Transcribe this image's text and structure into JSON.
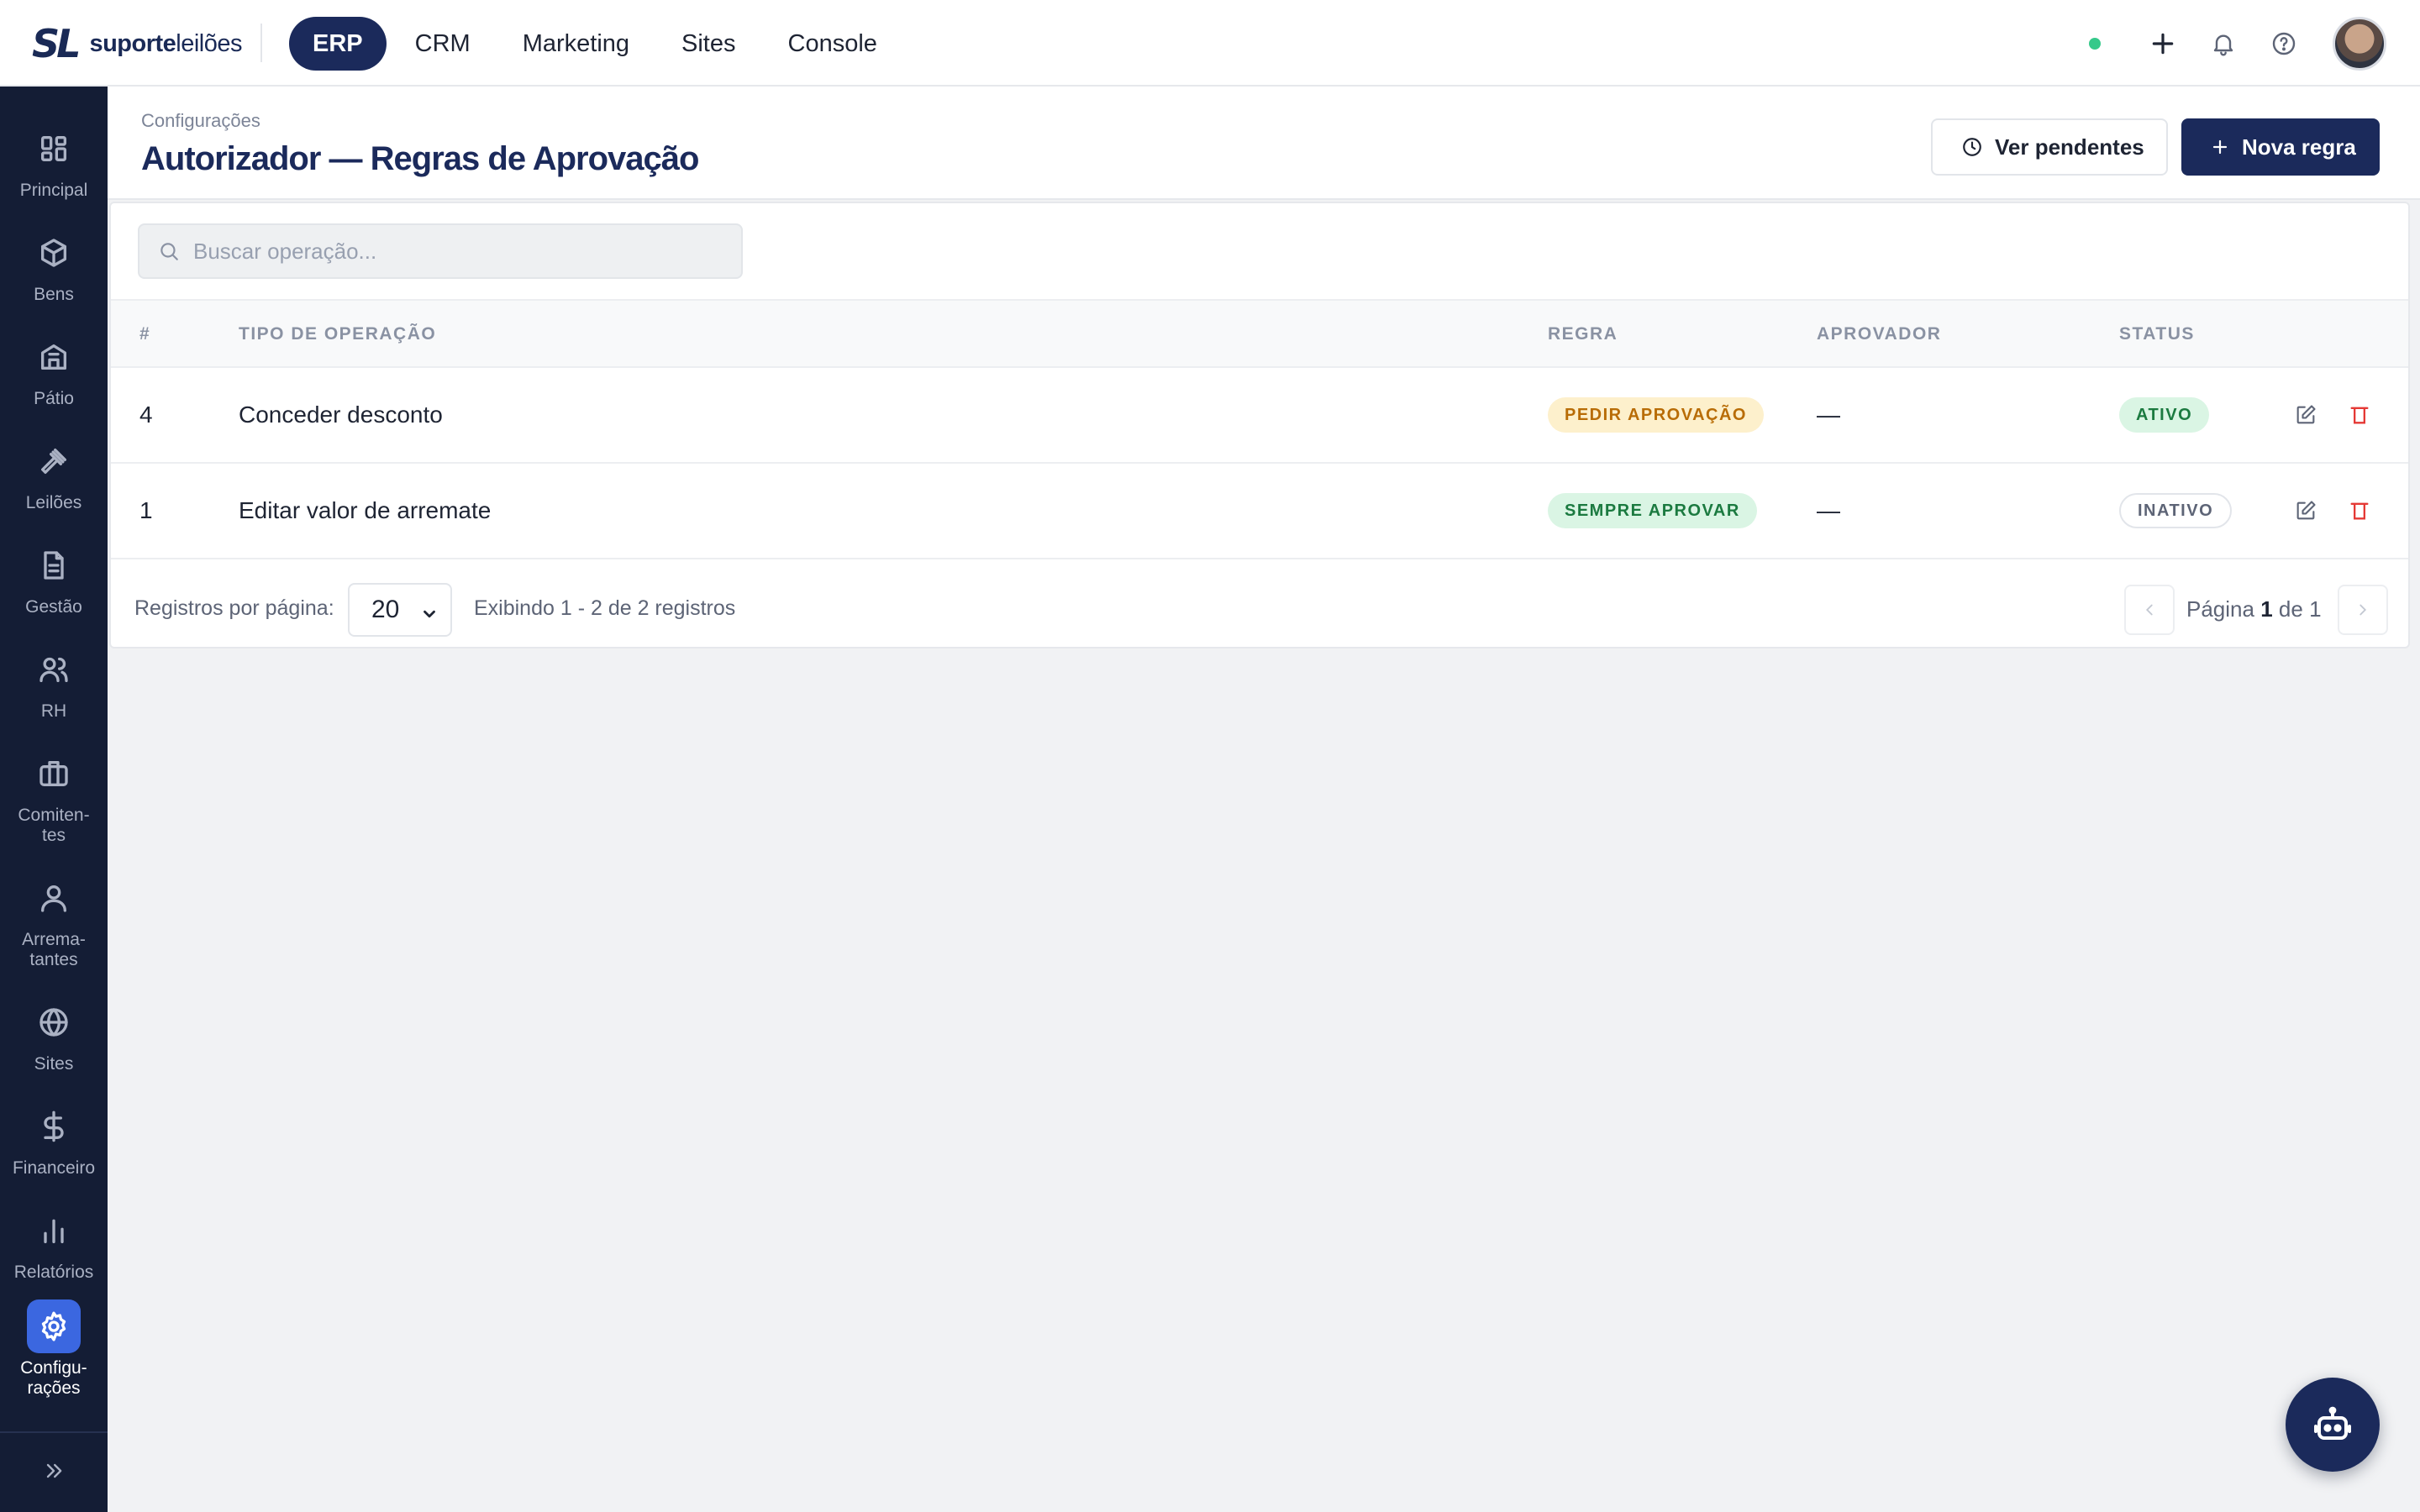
{
  "brand": {
    "mark": "SL",
    "name_bold": "suporte",
    "name_light": "leilões"
  },
  "topnav": [
    {
      "label": "ERP",
      "active": true
    },
    {
      "label": "CRM",
      "active": false
    },
    {
      "label": "Marketing",
      "active": false
    },
    {
      "label": "Sites",
      "active": false
    },
    {
      "label": "Console",
      "active": false
    }
  ],
  "top_actions": {
    "status_color": "#35c98a",
    "icons": [
      "plus-icon",
      "bell-icon",
      "help-icon"
    ]
  },
  "sidebar": {
    "items": [
      {
        "label": "Principal",
        "icon": "grid-icon"
      },
      {
        "label": "Bens",
        "icon": "box-icon"
      },
      {
        "label": "Pátio",
        "icon": "warehouse-icon"
      },
      {
        "label": "Leilões",
        "icon": "gavel-icon"
      },
      {
        "label": "Gestão",
        "icon": "document-icon"
      },
      {
        "label": "RH",
        "icon": "users-icon"
      },
      {
        "label": "Comiten-\ntes",
        "icon": "briefcase-icon"
      },
      {
        "label": "Arrema-\ntantes",
        "icon": "user-icon"
      },
      {
        "label": "Sites",
        "icon": "globe-icon"
      },
      {
        "label": "Financeiro",
        "icon": "dollar-icon"
      },
      {
        "label": "Relatórios",
        "icon": "bar-chart-icon"
      },
      {
        "label": "Configu-\nrações",
        "icon": "gear-icon",
        "active": true
      }
    ],
    "collapse_icon": "chevrons-right-icon"
  },
  "header": {
    "breadcrumb": "Configurações",
    "title": "Autorizador — Regras de Aprovação",
    "pending_label": "Ver pendentes",
    "new_label": "Nova regra"
  },
  "search": {
    "placeholder": "Buscar operação...",
    "value": ""
  },
  "table": {
    "columns": [
      "#",
      "TIPO DE OPERAÇÃO",
      "REGRA",
      "APROVADOR",
      "STATUS"
    ],
    "rows": [
      {
        "id": "4",
        "operation": "Conceder desconto",
        "rule": "PEDIR APROVAÇÃO",
        "approver": "—",
        "status": "ATIVO"
      },
      {
        "id": "1",
        "operation": "Editar valor de arremate",
        "rule": "SEMPRE APROVAR",
        "approver": "—",
        "status": "INATIVO"
      }
    ]
  },
  "pagination": {
    "per_page_label": "Registros por página:",
    "per_page_value": "20",
    "showing": "Exibindo 1 - 2 de 2 registros",
    "page_prefix": "Página",
    "page_current": "1",
    "page_sep": "de",
    "page_total": "1"
  },
  "colors": {
    "brand_navy": "#1b2a5b",
    "sidebar_bg": "#141d35",
    "accent_blue": "#3b67e0",
    "danger": "#e53935"
  }
}
